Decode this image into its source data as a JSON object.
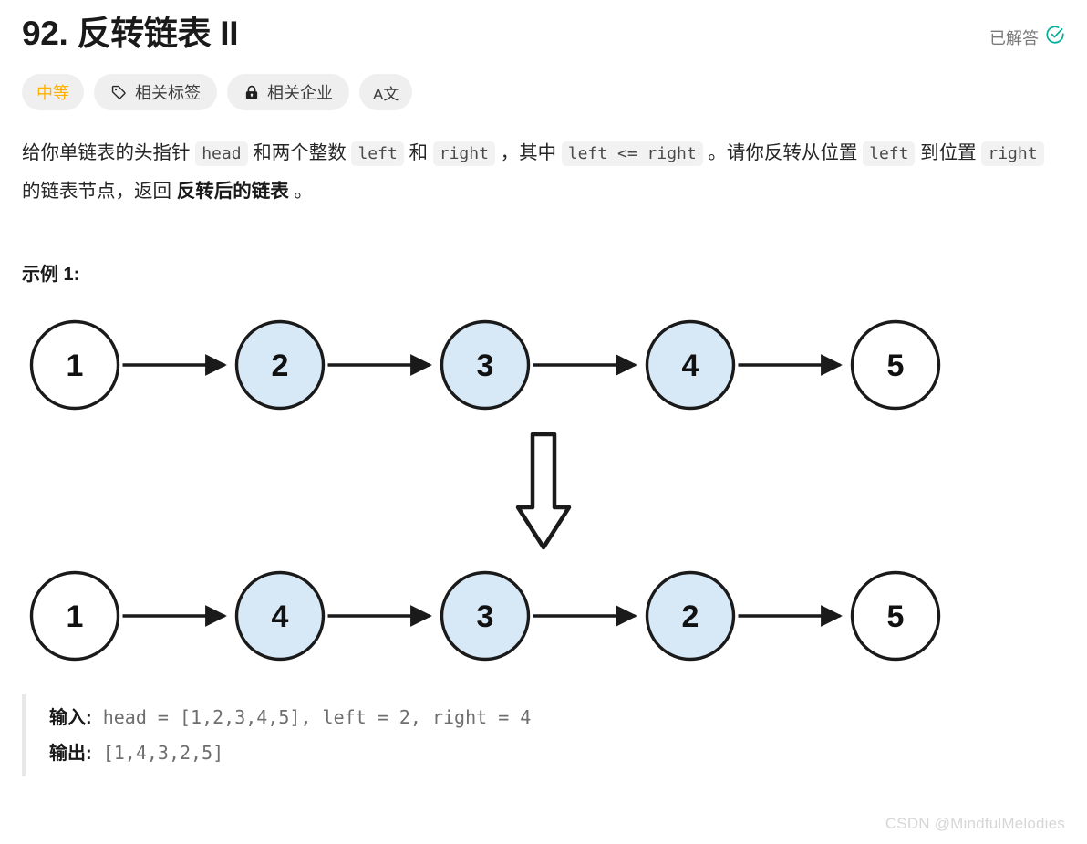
{
  "header": {
    "title": "92. 反转链表 II",
    "status_label": "已解答",
    "status_icon": "check-circle-icon",
    "status_color": "#00af9b"
  },
  "pills": [
    {
      "label": "中等",
      "icon": null,
      "name": "difficulty-badge",
      "color": "#ffb103"
    },
    {
      "label": "相关标签",
      "icon": "tag-icon",
      "name": "related-tags-button"
    },
    {
      "label": "相关企业",
      "icon": "lock-icon",
      "name": "related-companies-button"
    },
    {
      "label": "A文",
      "icon": null,
      "name": "language-toggle-button"
    }
  ],
  "description": {
    "part1": "给你单链表的头指针 ",
    "code1": "head",
    "part2": " 和两个整数 ",
    "code2": "left",
    "part3": " 和 ",
    "code3": "right",
    "part4": " ，其中 ",
    "code4": "left <= right",
    "part5": " 。请你反转从位置 ",
    "code5": "left",
    "part6": " 到位置 ",
    "code6": "right",
    "part7": " 的链表节点，返回 ",
    "bold1": "反转后的链表",
    "part8": " 。"
  },
  "example": {
    "heading": "示例 1:",
    "input_label": "输入:",
    "input_value": "head = [1,2,3,4,5], left = 2, right = 4",
    "output_label": "输出:",
    "output_value": "[1,4,3,2,5]"
  },
  "diagram": {
    "highlight_fill": "#d7e8f7",
    "plain_fill": "#ffffff",
    "stroke": "#1a1a1a",
    "before": {
      "nodes": [
        {
          "value": "1",
          "highlighted": false
        },
        {
          "value": "2",
          "highlighted": true
        },
        {
          "value": "3",
          "highlighted": true
        },
        {
          "value": "4",
          "highlighted": true
        },
        {
          "value": "5",
          "highlighted": false
        }
      ]
    },
    "transform_icon": "down-block-arrow-icon",
    "after": {
      "nodes": [
        {
          "value": "1",
          "highlighted": false
        },
        {
          "value": "4",
          "highlighted": true
        },
        {
          "value": "3",
          "highlighted": true
        },
        {
          "value": "2",
          "highlighted": true
        },
        {
          "value": "5",
          "highlighted": false
        }
      ]
    }
  },
  "watermark": "CSDN @MindfulMelodies"
}
